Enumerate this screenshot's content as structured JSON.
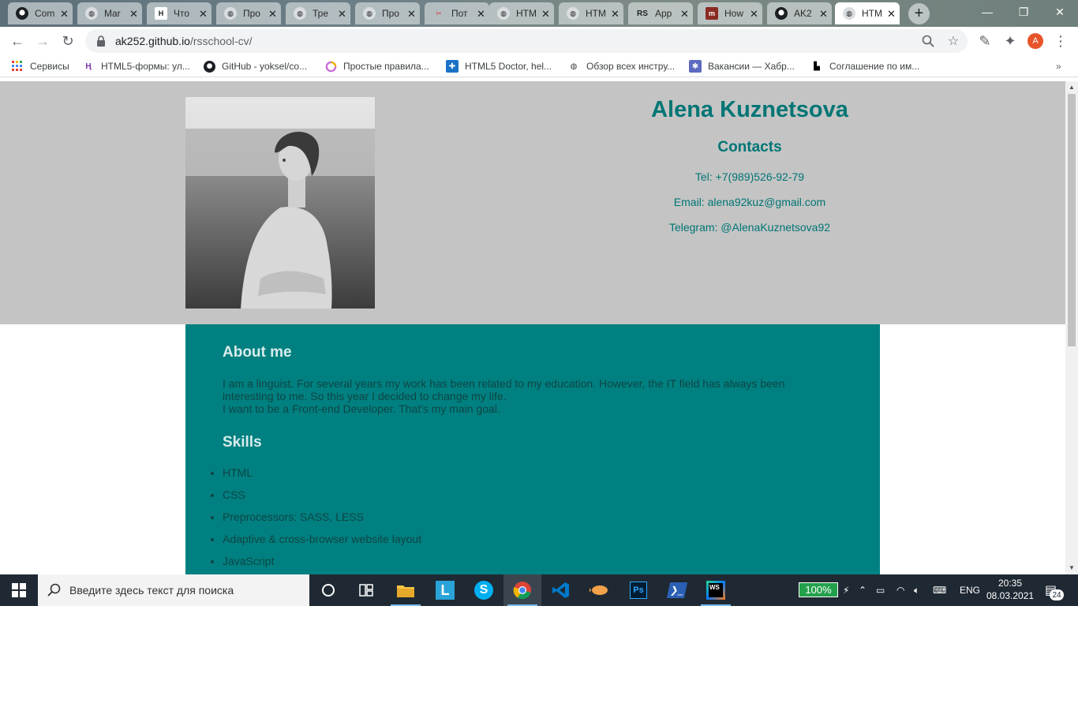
{
  "browser": {
    "tabs": [
      {
        "title": "Com",
        "icon": "github-icon",
        "active": false
      },
      {
        "title": "Mar",
        "icon": "globe-icon",
        "active": false
      },
      {
        "title": "Что",
        "icon": "habr-icon",
        "active": false
      },
      {
        "title": "Про",
        "icon": "globe-icon",
        "active": false
      },
      {
        "title": "Тре",
        "icon": "globe-icon",
        "active": false
      },
      {
        "title": "Про",
        "icon": "globe-icon",
        "active": false
      },
      {
        "title": "Пот",
        "icon": "scissors-icon",
        "active": false
      },
      {
        "title": "HTM",
        "icon": "globe-icon",
        "active": false
      },
      {
        "title": "HTM",
        "icon": "globe-icon",
        "active": false
      },
      {
        "title": "App",
        "icon": "rs-icon",
        "active": false
      },
      {
        "title": "How",
        "icon": "m-icon",
        "active": false
      },
      {
        "title": "AK2",
        "icon": "github-icon",
        "active": false
      },
      {
        "title": "HTM",
        "icon": "globe-icon",
        "active": true
      }
    ],
    "url_host": "ak252.github.io",
    "url_path": "/rsschool-cv/",
    "profile_initial": "A",
    "bookmarks": [
      {
        "label": "Сервисы",
        "icon": "apps-grid-icon"
      },
      {
        "label": "HTML5-формы: ул...",
        "icon": "html5-forms-icon"
      },
      {
        "label": "GitHub - yoksel/co...",
        "icon": "github-icon"
      },
      {
        "label": "Простые правила...",
        "icon": "circle-rainbow-icon"
      },
      {
        "label": "HTML5 Doctor, hel...",
        "icon": "html5doctor-icon"
      },
      {
        "label": "Обзор всех инстру...",
        "icon": "globe-icon"
      },
      {
        "label": "Вакансии — Хабр...",
        "icon": "habr-career-icon"
      },
      {
        "label": "Соглашение по им...",
        "icon": "bem-icon"
      }
    ]
  },
  "page": {
    "name": "Alena Kuznetsova",
    "contacts_heading": "Contacts",
    "contacts": [
      "Tel: +7(989)526-92-79",
      "Email: alena92kuz@gmail.com",
      "Telegram: @AlenaKuznetsova92"
    ],
    "about_heading": "About me",
    "about_lines": [
      "I am a linguist. For several years my work has been related to my education. However, the IT field has always been interesting to me. So this year I decided to change my life.",
      "I want to be a Front-end Developer. That's my main goal."
    ],
    "skills_heading": "Skills",
    "skills": [
      "HTML",
      "CSS",
      "Preprocessors: SASS, LESS",
      "Adaptive & cross-browser website layout",
      "JavaScript"
    ],
    "colors": {
      "header_bg": "#c4c4c4",
      "accent": "#007575",
      "panel_bg": "#008080"
    }
  },
  "taskbar": {
    "search_placeholder": "Введите здесь текст для поиска",
    "apps": [
      "cortana-icon",
      "task-view-icon",
      "file-explorer-icon",
      "lingvo-icon",
      "skype-icon",
      "chrome-icon",
      "vscode-icon",
      "fish-app-icon",
      "photoshop-icon",
      "powershell-icon",
      "webstorm-icon"
    ],
    "battery": "100%",
    "language": "ENG",
    "time": "20:35",
    "date": "08.03.2021",
    "notifications": "24"
  }
}
